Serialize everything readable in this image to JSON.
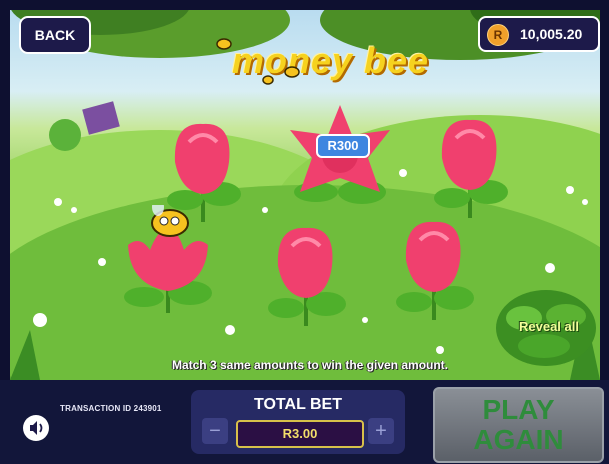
{
  "header": {
    "back_label": "BACK",
    "currency_symbol": "R",
    "balance": "10,005.20"
  },
  "game": {
    "logo": "money bee",
    "revealed_prize": "R300",
    "flowers": [
      {
        "id": "top-left",
        "state": "closed"
      },
      {
        "id": "top-center",
        "state": "open",
        "prize": "R300"
      },
      {
        "id": "top-right",
        "state": "closed"
      },
      {
        "id": "bottom-left",
        "state": "open"
      },
      {
        "id": "bottom-center",
        "state": "closed"
      },
      {
        "id": "bottom-right",
        "state": "closed"
      }
    ],
    "reveal_all_label": "Reveal all",
    "instruction": "Match 3 same amounts to win the given amount."
  },
  "footer": {
    "transaction_label": "TRANSACTION ID 243901",
    "total_bet_label": "TOTAL BET",
    "bet_value": "R3.00",
    "minus_symbol": "−",
    "plus_symbol": "+",
    "play_again_line1": "PLAY",
    "play_again_line2": "AGAIN"
  },
  "colors": {
    "flower_pink": "#f0406e",
    "panel_navy": "#1d1a4a",
    "prize_blue": "#3e86e0",
    "play_again_green": "#2f8c3c"
  }
}
